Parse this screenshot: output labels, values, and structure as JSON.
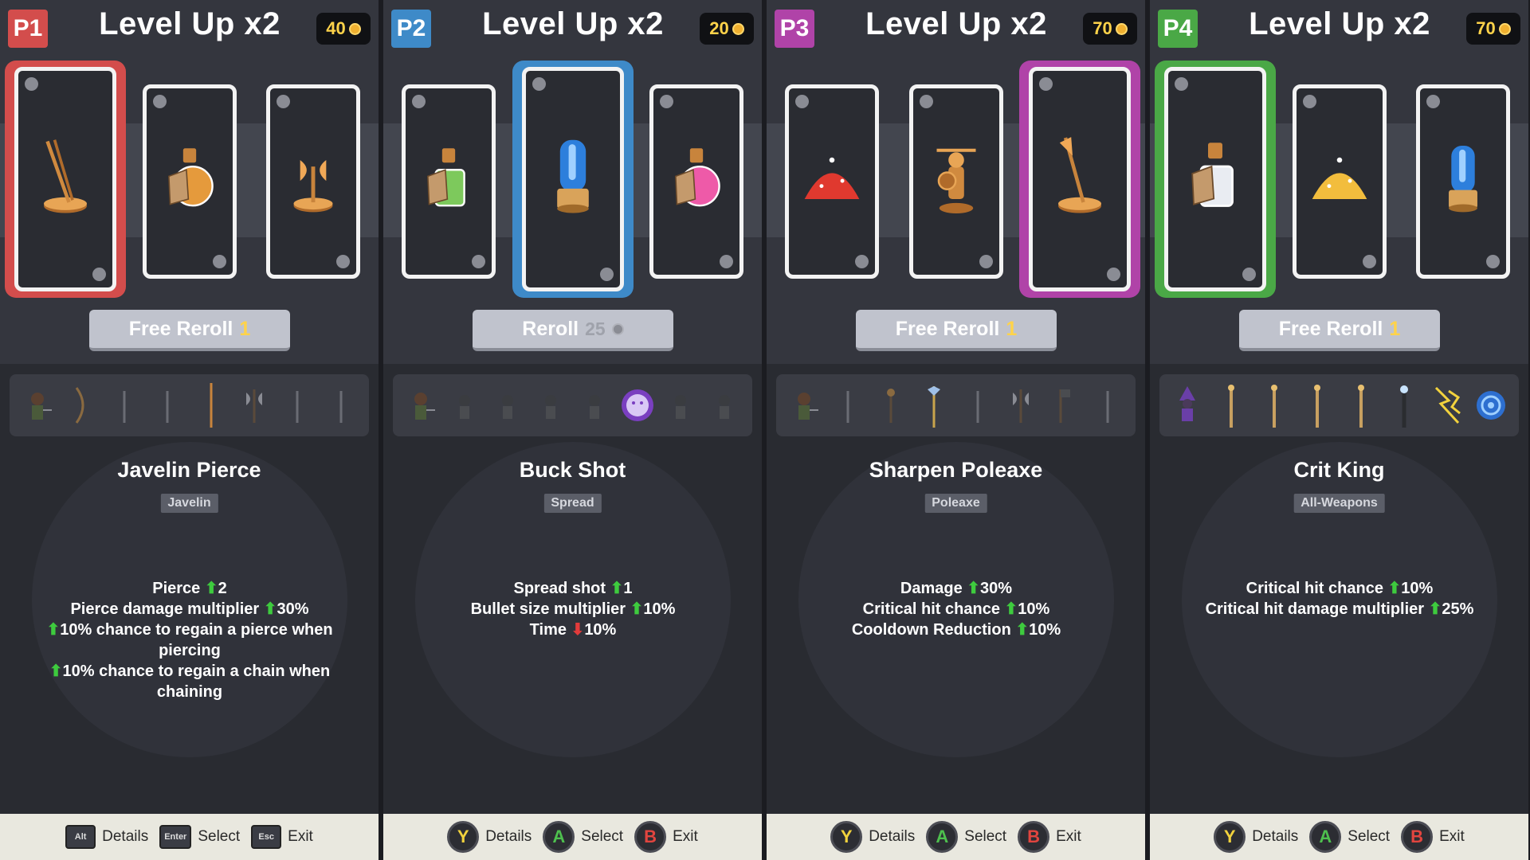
{
  "panels": [
    {
      "player": "P1",
      "color": "#d34d4c",
      "title": "Level Up x2",
      "gold": "40",
      "reroll": {
        "label": "Free Reroll",
        "count": "1",
        "cost": ""
      },
      "selected_card": 1,
      "skill": "Javelin Pierce",
      "tag": "Javelin",
      "stats": [
        {
          "pre": "",
          "text": "Pierce",
          "arrow": "up",
          "value": "2",
          "post": ""
        },
        {
          "pre": "",
          "text": "Pierce damage multiplier",
          "arrow": "up",
          "value": "30%",
          "post": ""
        },
        {
          "pre": "up",
          "text": "",
          "arrow": "",
          "value": "",
          "post": "10% chance to regain a pierce when piercing"
        },
        {
          "pre": "up",
          "text": "",
          "arrow": "",
          "value": "",
          "post": "10% chance to regain a chain when chaining"
        }
      ],
      "footer": [
        {
          "key": "Alt",
          "label": "Details"
        },
        {
          "key": "Enter",
          "label": "Select"
        },
        {
          "key": "Esc",
          "label": "Exit"
        }
      ]
    },
    {
      "player": "P2",
      "color": "#3e8ac8",
      "title": "Level Up x2",
      "gold": "20",
      "reroll": {
        "label": "Reroll",
        "count": "",
        "cost": "25"
      },
      "selected_card": 2,
      "skill": "Buck Shot",
      "tag": "Spread",
      "stats": [
        {
          "pre": "",
          "text": "Spread shot",
          "arrow": "up",
          "value": "1",
          "post": ""
        },
        {
          "pre": "",
          "text": "Bullet size multiplier",
          "arrow": "up",
          "value": "10%",
          "post": ""
        },
        {
          "pre": "",
          "text": "Time",
          "arrow": "down",
          "value": "10%",
          "post": ""
        }
      ],
      "footer": [
        {
          "key": "Y",
          "label": "Details"
        },
        {
          "key": "A",
          "label": "Select"
        },
        {
          "key": "B",
          "label": "Exit"
        }
      ]
    },
    {
      "player": "P3",
      "color": "#b043a8",
      "title": "Level Up x2",
      "gold": "70",
      "reroll": {
        "label": "Free Reroll",
        "count": "1",
        "cost": ""
      },
      "selected_card": 3,
      "skill": "Sharpen Poleaxe",
      "tag": "Poleaxe",
      "stats": [
        {
          "pre": "",
          "text": "Damage",
          "arrow": "up",
          "value": "30%",
          "post": ""
        },
        {
          "pre": "",
          "text": "Critical hit chance",
          "arrow": "up",
          "value": "10%",
          "post": ""
        },
        {
          "pre": "",
          "text": "Cooldown Reduction",
          "arrow": "up",
          "value": "10%",
          "post": ""
        }
      ],
      "footer": [
        {
          "key": "Y",
          "label": "Details"
        },
        {
          "key": "A",
          "label": "Select"
        },
        {
          "key": "B",
          "label": "Exit"
        }
      ]
    },
    {
      "player": "P4",
      "color": "#4aa846",
      "title": "Level Up x2",
      "gold": "70",
      "reroll": {
        "label": "Free Reroll",
        "count": "1",
        "cost": ""
      },
      "selected_card": 1,
      "skill": "Crit King",
      "tag": "All-Weapons",
      "stats": [
        {
          "pre": "",
          "text": "Critical hit chance",
          "arrow": "up",
          "value": "10%",
          "post": ""
        },
        {
          "pre": "",
          "text": "Critical hit damage multiplier",
          "arrow": "up",
          "value": "25%",
          "post": ""
        }
      ],
      "footer": [
        {
          "key": "Y",
          "label": "Details"
        },
        {
          "key": "A",
          "label": "Select"
        },
        {
          "key": "B",
          "label": "Exit"
        }
      ]
    }
  ],
  "cards": [
    [
      "javelin-statue-icon",
      "potion-orange-icon",
      "axe-statue-icon"
    ],
    [
      "potion-rainbow-icon",
      "shell-blue-icon",
      "potion-pink-icon"
    ],
    [
      "pile-red-icon",
      "warrior-statue-icon",
      "poleaxe-statue-icon"
    ],
    [
      "potion-white-icon",
      "pile-gold-icon",
      "shell-blue-small-icon"
    ]
  ],
  "weapon_bars": [
    [
      "character-icon",
      "bow-icon",
      "spear-icon",
      "dagger-icon",
      "javelin-icon",
      "axe-icon",
      "blade-icon",
      "staff-icon"
    ],
    [
      "character-icon",
      "soldier-icon",
      "soldier-icon",
      "soldier-icon",
      "soldier-icon",
      "moon-icon",
      "soldier-icon",
      "soldier-icon"
    ],
    [
      "character-icon",
      "spear-icon",
      "mace-icon",
      "poleaxe-icon",
      "spear-icon",
      "axe-icon",
      "flag-icon",
      "spear-icon"
    ],
    [
      "wizard-icon",
      "wand-icon",
      "wand-icon",
      "wand-icon",
      "wand-icon",
      "scepter-icon",
      "lightning-icon",
      "vortex-icon"
    ]
  ],
  "pad_colors": {
    "Y": "#f2d23d",
    "A": "#4ec04e",
    "B": "#e2453f"
  }
}
